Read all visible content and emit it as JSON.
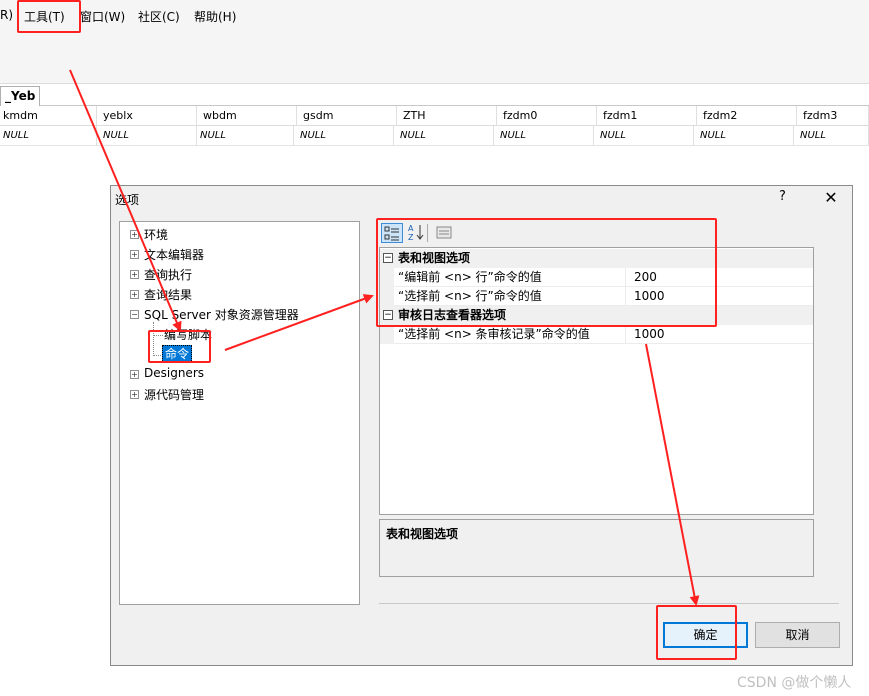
{
  "menubar": {
    "items": [
      "R)",
      "工具(T)",
      "窗口(W)",
      "社区(C)",
      "帮助(H)"
    ]
  },
  "tab": {
    "label": "_Yeb"
  },
  "grid": {
    "columns": [
      "kmdm",
      "yeblx",
      "wbdm",
      "gsdm",
      "ZTH",
      "fzdm0",
      "fzdm1",
      "fzdm2",
      "fzdm3"
    ],
    "rows": [
      [
        "NULL",
        "NULL",
        "NULL",
        "NULL",
        "NULL",
        "NULL",
        "NULL",
        "NULL",
        "NULL"
      ]
    ]
  },
  "dialog": {
    "title": "选项",
    "help_label": "?",
    "close_label": "✕",
    "tree": [
      {
        "label": "环境"
      },
      {
        "label": "文本编辑器"
      },
      {
        "label": "查询执行"
      },
      {
        "label": "查询结果"
      },
      {
        "label": "SQL Server 对象资源管理器"
      },
      {
        "label": "编写脚本"
      },
      {
        "label": "命令"
      },
      {
        "label": "Designers"
      },
      {
        "label": "源代码管理"
      }
    ],
    "toolbar": {
      "categorized_icon": "categorized-icon",
      "alphabetical_icon": "sort-az-icon",
      "property_pages_icon": "property-pages-icon"
    },
    "property_grid": {
      "categories": [
        {
          "name": "表和视图选项",
          "toggle": "⊟",
          "rows": [
            {
              "name": "“编辑前 <n> 行”命令的值",
              "value": "200"
            },
            {
              "name": "“选择前 <n> 行”命令的值",
              "value": "1000"
            }
          ]
        },
        {
          "name": "审核日志查看器选项",
          "toggle": "⊟",
          "rows": [
            {
              "name": "“选择前 <n> 条审核记录”命令的值",
              "value": "1000"
            }
          ]
        }
      ]
    },
    "description": "表和视图选项",
    "ok_label": "确定",
    "cancel_label": "取消"
  },
  "watermark": "CSDN @做个懒人",
  "annotation_color": "#ff2020"
}
